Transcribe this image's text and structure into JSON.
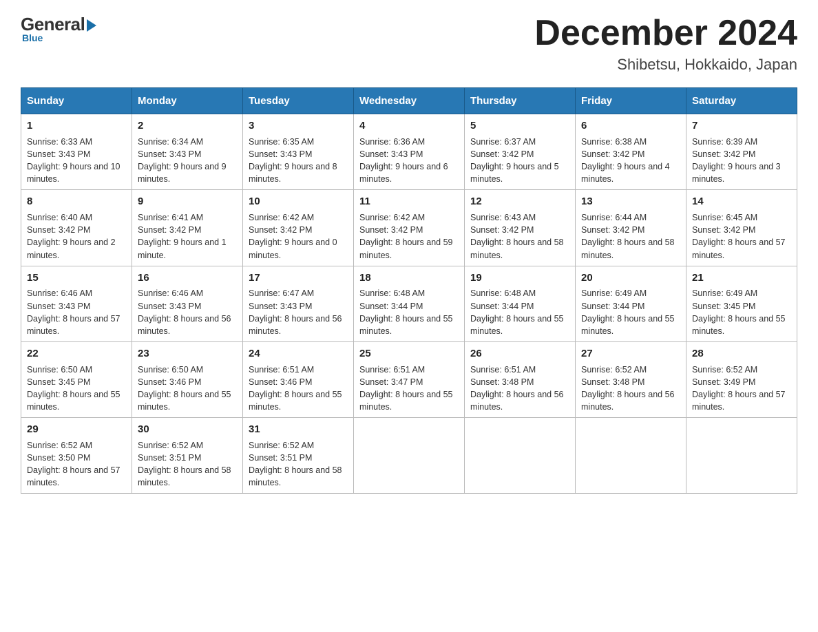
{
  "logo": {
    "general": "General",
    "blue": "Blue"
  },
  "title": {
    "month_year": "December 2024",
    "location": "Shibetsu, Hokkaido, Japan"
  },
  "days_of_week": [
    "Sunday",
    "Monday",
    "Tuesday",
    "Wednesday",
    "Thursday",
    "Friday",
    "Saturday"
  ],
  "weeks": [
    [
      {
        "day": "1",
        "sunrise": "6:33 AM",
        "sunset": "3:43 PM",
        "daylight": "9 hours and 10 minutes."
      },
      {
        "day": "2",
        "sunrise": "6:34 AM",
        "sunset": "3:43 PM",
        "daylight": "9 hours and 9 minutes."
      },
      {
        "day": "3",
        "sunrise": "6:35 AM",
        "sunset": "3:43 PM",
        "daylight": "9 hours and 8 minutes."
      },
      {
        "day": "4",
        "sunrise": "6:36 AM",
        "sunset": "3:43 PM",
        "daylight": "9 hours and 6 minutes."
      },
      {
        "day": "5",
        "sunrise": "6:37 AM",
        "sunset": "3:42 PM",
        "daylight": "9 hours and 5 minutes."
      },
      {
        "day": "6",
        "sunrise": "6:38 AM",
        "sunset": "3:42 PM",
        "daylight": "9 hours and 4 minutes."
      },
      {
        "day": "7",
        "sunrise": "6:39 AM",
        "sunset": "3:42 PM",
        "daylight": "9 hours and 3 minutes."
      }
    ],
    [
      {
        "day": "8",
        "sunrise": "6:40 AM",
        "sunset": "3:42 PM",
        "daylight": "9 hours and 2 minutes."
      },
      {
        "day": "9",
        "sunrise": "6:41 AM",
        "sunset": "3:42 PM",
        "daylight": "9 hours and 1 minute."
      },
      {
        "day": "10",
        "sunrise": "6:42 AM",
        "sunset": "3:42 PM",
        "daylight": "9 hours and 0 minutes."
      },
      {
        "day": "11",
        "sunrise": "6:42 AM",
        "sunset": "3:42 PM",
        "daylight": "8 hours and 59 minutes."
      },
      {
        "day": "12",
        "sunrise": "6:43 AM",
        "sunset": "3:42 PM",
        "daylight": "8 hours and 58 minutes."
      },
      {
        "day": "13",
        "sunrise": "6:44 AM",
        "sunset": "3:42 PM",
        "daylight": "8 hours and 58 minutes."
      },
      {
        "day": "14",
        "sunrise": "6:45 AM",
        "sunset": "3:42 PM",
        "daylight": "8 hours and 57 minutes."
      }
    ],
    [
      {
        "day": "15",
        "sunrise": "6:46 AM",
        "sunset": "3:43 PM",
        "daylight": "8 hours and 57 minutes."
      },
      {
        "day": "16",
        "sunrise": "6:46 AM",
        "sunset": "3:43 PM",
        "daylight": "8 hours and 56 minutes."
      },
      {
        "day": "17",
        "sunrise": "6:47 AM",
        "sunset": "3:43 PM",
        "daylight": "8 hours and 56 minutes."
      },
      {
        "day": "18",
        "sunrise": "6:48 AM",
        "sunset": "3:44 PM",
        "daylight": "8 hours and 55 minutes."
      },
      {
        "day": "19",
        "sunrise": "6:48 AM",
        "sunset": "3:44 PM",
        "daylight": "8 hours and 55 minutes."
      },
      {
        "day": "20",
        "sunrise": "6:49 AM",
        "sunset": "3:44 PM",
        "daylight": "8 hours and 55 minutes."
      },
      {
        "day": "21",
        "sunrise": "6:49 AM",
        "sunset": "3:45 PM",
        "daylight": "8 hours and 55 minutes."
      }
    ],
    [
      {
        "day": "22",
        "sunrise": "6:50 AM",
        "sunset": "3:45 PM",
        "daylight": "8 hours and 55 minutes."
      },
      {
        "day": "23",
        "sunrise": "6:50 AM",
        "sunset": "3:46 PM",
        "daylight": "8 hours and 55 minutes."
      },
      {
        "day": "24",
        "sunrise": "6:51 AM",
        "sunset": "3:46 PM",
        "daylight": "8 hours and 55 minutes."
      },
      {
        "day": "25",
        "sunrise": "6:51 AM",
        "sunset": "3:47 PM",
        "daylight": "8 hours and 55 minutes."
      },
      {
        "day": "26",
        "sunrise": "6:51 AM",
        "sunset": "3:48 PM",
        "daylight": "8 hours and 56 minutes."
      },
      {
        "day": "27",
        "sunrise": "6:52 AM",
        "sunset": "3:48 PM",
        "daylight": "8 hours and 56 minutes."
      },
      {
        "day": "28",
        "sunrise": "6:52 AM",
        "sunset": "3:49 PM",
        "daylight": "8 hours and 57 minutes."
      }
    ],
    [
      {
        "day": "29",
        "sunrise": "6:52 AM",
        "sunset": "3:50 PM",
        "daylight": "8 hours and 57 minutes."
      },
      {
        "day": "30",
        "sunrise": "6:52 AM",
        "sunset": "3:51 PM",
        "daylight": "8 hours and 58 minutes."
      },
      {
        "day": "31",
        "sunrise": "6:52 AM",
        "sunset": "3:51 PM",
        "daylight": "8 hours and 58 minutes."
      },
      null,
      null,
      null,
      null
    ]
  ]
}
